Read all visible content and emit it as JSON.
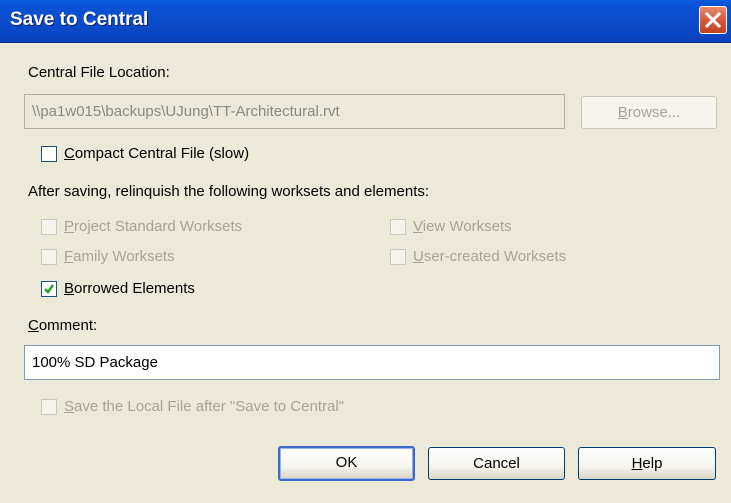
{
  "window": {
    "title": "Save to Central"
  },
  "central_file": {
    "label": "Central File Location:",
    "path": "\\\\pa1w015\\backups\\UJung\\TT-Architectural.rvt",
    "browse_button": {
      "label_first": "B",
      "label_rest": "rowse..."
    }
  },
  "compact": {
    "label_first": "C",
    "label_rest": "ompact Central File (slow)",
    "checked": false
  },
  "relinquish": {
    "heading": "After saving, relinquish the following worksets and elements:",
    "project_standard": {
      "label_first": "P",
      "label_rest": "roject Standard Worksets",
      "checked": false,
      "enabled": false
    },
    "view": {
      "label_first": "V",
      "label_rest": "iew Worksets",
      "checked": false,
      "enabled": false
    },
    "family": {
      "label_first": "F",
      "label_rest": "amily Worksets",
      "checked": false,
      "enabled": false
    },
    "user_created": {
      "label_first": "U",
      "label_rest": "ser-created Worksets",
      "checked": false,
      "enabled": false
    },
    "borrowed": {
      "label_first": "B",
      "label_rest": "orrowed Elements",
      "checked": true,
      "enabled": true
    }
  },
  "comment": {
    "label_first": "C",
    "label_rest": "omment:",
    "value": "100% SD Package"
  },
  "save_local": {
    "label_first": "S",
    "label_rest": "ave the Local File after \"Save to Central\"",
    "checked": false,
    "enabled": false
  },
  "buttons": {
    "ok": "OK",
    "cancel": "Cancel",
    "help_first": "H",
    "help_rest": "elp"
  },
  "icons": {
    "close": "close-icon",
    "checkmark": "checkmark-icon"
  },
  "colors": {
    "titlebar": "#0a4fcf",
    "dialog_bg": "#ece9d8",
    "disabled_text": "#a7a494",
    "close_red": "#d65a3a"
  }
}
